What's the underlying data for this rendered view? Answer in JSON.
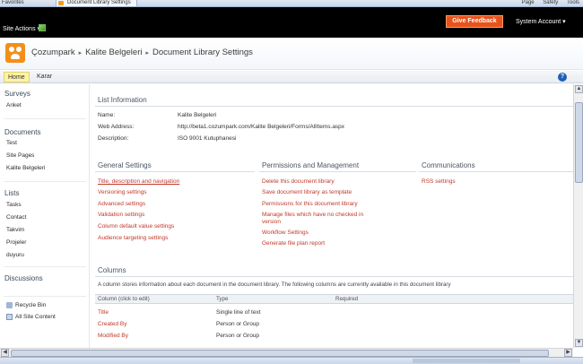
{
  "browser": {
    "favorites": "Favorites",
    "tab_title": "Document Library Settings",
    "tools": [
      "Page",
      "Safety",
      "Tools"
    ]
  },
  "ribbon": {
    "site_actions": "Site Actions ▾",
    "feedback": "Give Feedback",
    "account": "System Account ▾"
  },
  "breadcrumb": [
    "Çozumpark",
    "Kalite Belgeleri",
    "Document Library Settings"
  ],
  "topnav": {
    "home": "Home",
    "karar": "Karar",
    "help": "?"
  },
  "leftnav": {
    "surveys": "Surveys",
    "anket": "Anket",
    "documents": "Documents",
    "doc_items": [
      "Test",
      "Site Pages",
      "Kalite Belgeleri"
    ],
    "lists": "Lists",
    "list_items": [
      "Tasks",
      "Contact",
      "Takvim",
      "Projeler",
      "duyuru"
    ],
    "discussions": "Discussions",
    "recycle": "Recycle Bin",
    "all_content": "All Site Content"
  },
  "list_info": {
    "title": "List Information",
    "name_label": "Name:",
    "name_value": "Kalite Belgeleri",
    "web_label": "Web Address:",
    "web_value": "http://beta1.cozumpark.com/Kalite Belgeleri/Forms/AllItems.aspx",
    "desc_label": "Description:",
    "desc_value": "ISO 9001 Kutuphanesi"
  },
  "general": {
    "title": "General Settings",
    "links": [
      "Title, description and navigation",
      "Versioning settings",
      "Advanced settings",
      "Validation settings",
      "Column default value settings",
      "Audience targeting settings"
    ]
  },
  "permissions": {
    "title": "Permissions and Management",
    "links": [
      "Delete this document library",
      "Save document library as template",
      "Permissions for this document library",
      "Manage files which have no checked in",
      "version",
      "Workflow Settings",
      "Generate file plan report"
    ]
  },
  "communications": {
    "title": "Communications",
    "links": [
      "RSS settings"
    ]
  },
  "columns": {
    "title": "Columns",
    "description": "A column stores information about each document in the document library. The following columns are currently available in this document library",
    "headers": [
      "Column (click to edit)",
      "Type",
      "Required"
    ],
    "rows": [
      {
        "name": "Title",
        "type": "Single line of text"
      },
      {
        "name": "Created By",
        "type": "Person or Group"
      },
      {
        "name": "Modified By",
        "type": "Person or Group"
      }
    ]
  }
}
